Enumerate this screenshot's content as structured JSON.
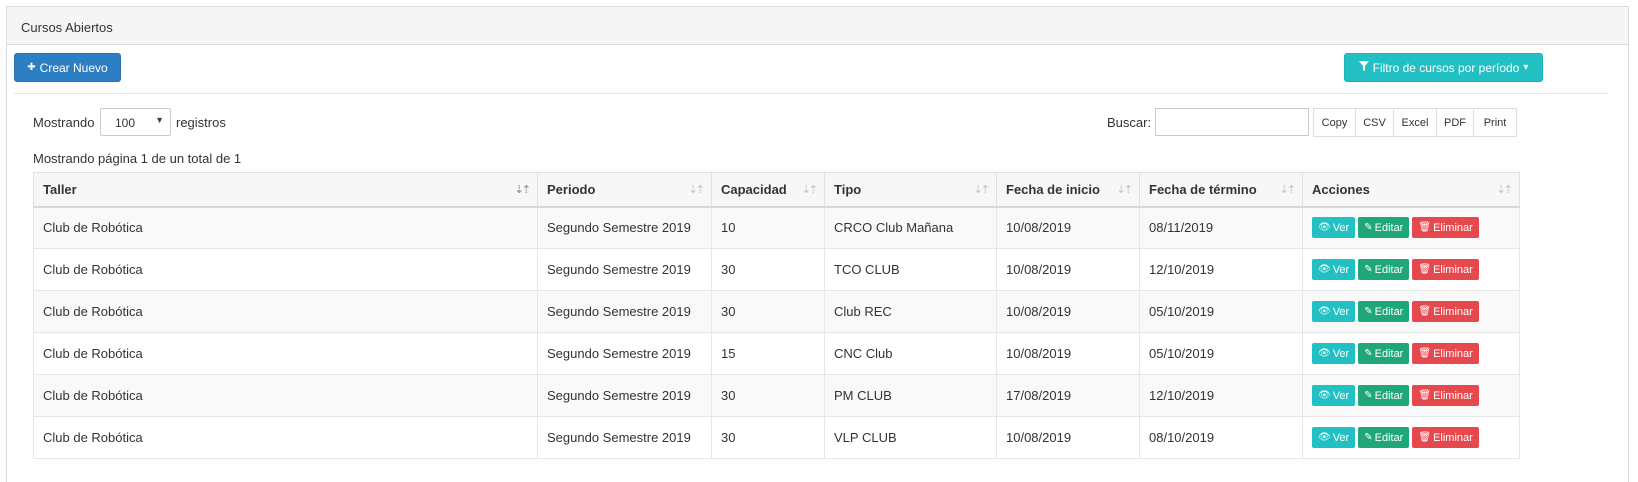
{
  "panel": {
    "title": "Cursos Abiertos"
  },
  "toolbar": {
    "create_label": "Crear Nuevo",
    "create_icon": "plus-icon",
    "filter_label": "Filtro de cursos por período",
    "filter_icon": "filter-icon"
  },
  "length": {
    "prefix": "Mostrando",
    "value": "100",
    "suffix": "registros"
  },
  "search": {
    "label": "Buscar:",
    "value": ""
  },
  "exports": [
    "Copy",
    "CSV",
    "Excel",
    "PDF",
    "Print"
  ],
  "page_info": "Mostrando página 1 de un total de 1",
  "table": {
    "columns": [
      "Taller",
      "Periodo",
      "Capacidad",
      "Tipo",
      "Fecha de inicio",
      "Fecha de término",
      "Acciones"
    ],
    "sorted_column": "Taller",
    "rows": [
      [
        "Club de Robótica",
        "Segundo Semestre 2019",
        "10",
        "CRCO Club Mañana",
        "10/08/2019",
        "08/11/2019"
      ],
      [
        "Club de Robótica",
        "Segundo Semestre 2019",
        "30",
        "TCO CLUB",
        "10/08/2019",
        "12/10/2019"
      ],
      [
        "Club de Robótica",
        "Segundo Semestre 2019",
        "30",
        "Club REC",
        "10/08/2019",
        "05/10/2019"
      ],
      [
        "Club de Robótica",
        "Segundo Semestre 2019",
        "15",
        "CNC Club",
        "10/08/2019",
        "05/10/2019"
      ],
      [
        "Club de Robótica",
        "Segundo Semestre 2019",
        "30",
        "PM CLUB",
        "17/08/2019",
        "12/10/2019"
      ],
      [
        "Club de Robótica",
        "Segundo Semestre 2019",
        "30",
        "VLP CLUB",
        "10/08/2019",
        "08/10/2019"
      ]
    ],
    "actions": {
      "view": "Ver",
      "edit": "Editar",
      "delete": "Eliminar"
    }
  },
  "colors": {
    "primary": "#2d7fc4",
    "info": "#22c0c2",
    "success": "#1fa67a",
    "danger": "#e5484d"
  }
}
